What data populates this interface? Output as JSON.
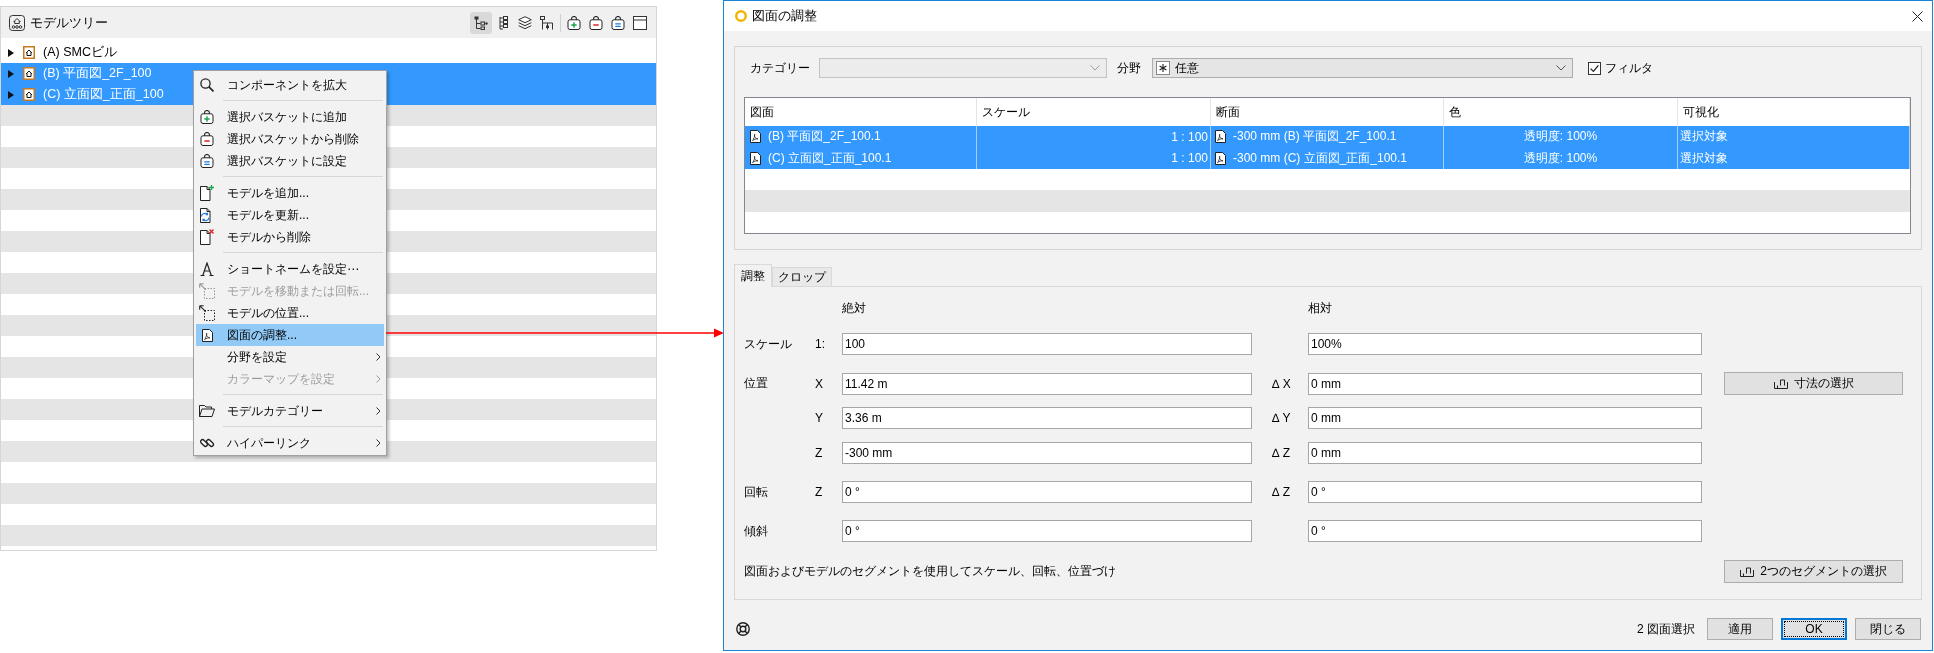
{
  "model_tree": {
    "title": "モデルツリー",
    "toolbar": [
      {
        "selected": true
      },
      {
        "selected": false
      },
      {
        "selected": false
      },
      {
        "selected": false
      },
      {
        "selected": false
      },
      {
        "selected": false
      },
      {
        "selected": false
      },
      {
        "selected": false
      }
    ],
    "items": [
      {
        "label": "(A) SMCビル",
        "expanded": false,
        "selected": false
      },
      {
        "label": "(B) 平面図_2F_100",
        "expanded": false,
        "selected": true
      },
      {
        "label": "(C) 立面図_正面_100",
        "expanded": false,
        "selected": true
      }
    ]
  },
  "context_menu": {
    "items": [
      {
        "kind": "item",
        "label": "コンポーネントを拡大",
        "disabled": false,
        "selected": false,
        "submenu": false
      },
      {
        "kind": "separator"
      },
      {
        "kind": "item",
        "label": "選択バスケットに追加",
        "disabled": false,
        "selected": false,
        "submenu": false
      },
      {
        "kind": "item",
        "label": "選択バスケットから削除",
        "disabled": false,
        "selected": false,
        "submenu": false
      },
      {
        "kind": "item",
        "label": "選択バスケットに設定",
        "disabled": false,
        "selected": false,
        "submenu": false
      },
      {
        "kind": "separator"
      },
      {
        "kind": "item",
        "label": "モデルを追加...",
        "disabled": false,
        "selected": false,
        "submenu": false
      },
      {
        "kind": "item",
        "label": "モデルを更新...",
        "disabled": false,
        "selected": false,
        "submenu": false
      },
      {
        "kind": "item",
        "label": "モデルから削除",
        "disabled": false,
        "selected": false,
        "submenu": false
      },
      {
        "kind": "separator"
      },
      {
        "kind": "item",
        "label": "ショートネームを設定⋯",
        "disabled": false,
        "selected": false,
        "submenu": false
      },
      {
        "kind": "item",
        "label": "モデルを移動または回転...",
        "disabled": true,
        "selected": false,
        "submenu": false
      },
      {
        "kind": "item",
        "label": "モデルの位置...",
        "disabled": false,
        "selected": false,
        "submenu": false
      },
      {
        "kind": "item",
        "label": "図面の調整...",
        "disabled": false,
        "selected": true,
        "submenu": false
      },
      {
        "kind": "item",
        "label": "分野を設定",
        "disabled": false,
        "selected": false,
        "submenu": true
      },
      {
        "kind": "item",
        "label": "カラーマップを設定",
        "disabled": true,
        "selected": false,
        "submenu": true
      },
      {
        "kind": "separator"
      },
      {
        "kind": "item",
        "label": "モデルカテゴリー",
        "disabled": false,
        "selected": false,
        "submenu": true
      },
      {
        "kind": "separator"
      },
      {
        "kind": "item",
        "label": "ハイパーリンク",
        "disabled": false,
        "selected": false,
        "submenu": true
      }
    ]
  },
  "dialog": {
    "title": "図面の調整",
    "filters": {
      "category_label": "カテゴリー",
      "category": {
        "disabled": true
      },
      "field_label": "分野",
      "field": {
        "value": "任意"
      },
      "filter": {
        "label": "フィルタ",
        "checked": true
      }
    },
    "table": {
      "columns": [
        "図面",
        "スケール",
        "断面",
        "色",
        "可視化"
      ],
      "rows": [
        {
          "selected": true,
          "cells": [
            "(B) 平面図_2F_100.1",
            "1 : 100",
            "-300 mm (B) 平面図_2F_100.1",
            "透明度: 100%",
            "選択対象"
          ]
        },
        {
          "selected": true,
          "cells": [
            "(C) 立面図_正面_100.1",
            "1 : 100",
            "-300 mm (C) 立面図_正面_100.1",
            "透明度: 100%",
            "選択対象"
          ]
        }
      ]
    },
    "tabs": [
      {
        "label": "調整",
        "selected": true
      },
      {
        "label": "クロップ",
        "selected": false
      }
    ],
    "adjust": {
      "headers": [
        "絶対",
        "相対"
      ],
      "rows": [
        {
          "label": "スケール",
          "axis": "1:",
          "absolute": "100",
          "relative": "100%"
        },
        {
          "label": "位置",
          "axis": "X",
          "absolute": "11.42 m",
          "delta": "∆ X",
          "relative": "0 mm",
          "button": "寸法の選択"
        },
        {
          "axis": "Y",
          "absolute": "3.36 m",
          "delta": "∆ Y",
          "relative": "0 mm"
        },
        {
          "axis": "Z",
          "absolute": "-300 mm",
          "delta": "∆ Z",
          "relative": "0 mm"
        },
        {
          "label": "回転",
          "axis": "Z",
          "absolute": "0 °",
          "delta": "∆ Z",
          "relative": "0 °"
        },
        {
          "label": "傾斜",
          "absolute": "0 °",
          "relative": "0 °"
        }
      ],
      "instruction": "図面およびモデルのセグメントを使用してスケール、回転、位置づけ",
      "segment_button": "2つのセグメントの選択"
    },
    "status": "2 図面選択",
    "buttons": [
      {
        "label": "適用",
        "focused": false
      },
      {
        "label": "OK",
        "focused": true
      },
      {
        "label": "閉じる",
        "focused": false
      }
    ]
  }
}
